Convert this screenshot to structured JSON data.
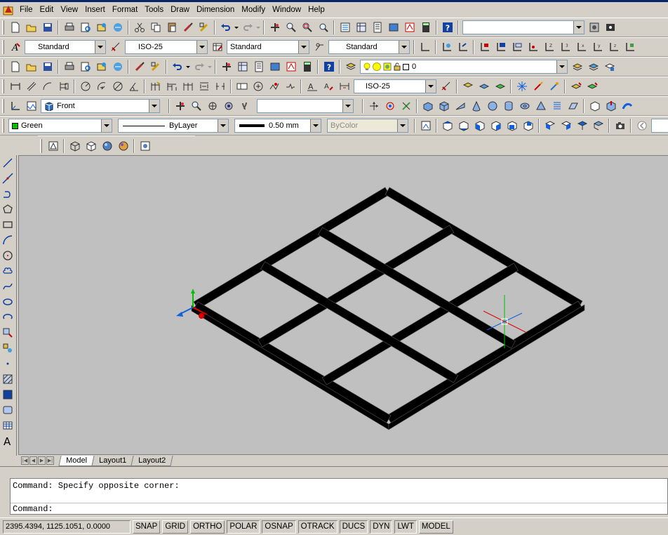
{
  "menubar": {
    "items": [
      "File",
      "Edit",
      "View",
      "Insert",
      "Format",
      "Tools",
      "Draw",
      "Dimension",
      "Modify",
      "Window",
      "Help"
    ]
  },
  "toolbars": {
    "standard_search_value": "",
    "text_style": "Standard",
    "dim_style": "ISO-25",
    "table_style": "Standard",
    "multileader_style": "Standard",
    "layer_value": "0",
    "dim_style_2": "ISO-25",
    "view_name": "Front",
    "named_ucs_value": "",
    "color_value": "Green",
    "linetype_value": "ByLayer",
    "lineweight_value": "0.50 mm",
    "plotstyle_value": "ByColor"
  },
  "layout_tabs": [
    {
      "label": "Model",
      "active": true
    },
    {
      "label": "Layout1",
      "active": false
    },
    {
      "label": "Layout2",
      "active": false
    }
  ],
  "command": {
    "history": "Command: Specify opposite corner:",
    "prompt": "Command:"
  },
  "status": {
    "coordinates": "2395.4394, 1125.1051, 0.0000",
    "buttons": [
      "SNAP",
      "GRID",
      "ORTHO",
      "POLAR",
      "OSNAP",
      "OTRACK",
      "DUCS",
      "DYN",
      "LWT",
      "MODEL"
    ],
    "pressed": [
      "POLAR",
      "OSNAP",
      "OTRACK",
      "DUCS",
      "DYN",
      "LWT"
    ]
  },
  "colors": {
    "viewport_bg": "#c0c0c0",
    "frame": "#000000",
    "layer_green": "#00c000",
    "ucs_x": "#e00000",
    "ucs_y": "#00c000",
    "ucs_z": "#1060e0"
  }
}
